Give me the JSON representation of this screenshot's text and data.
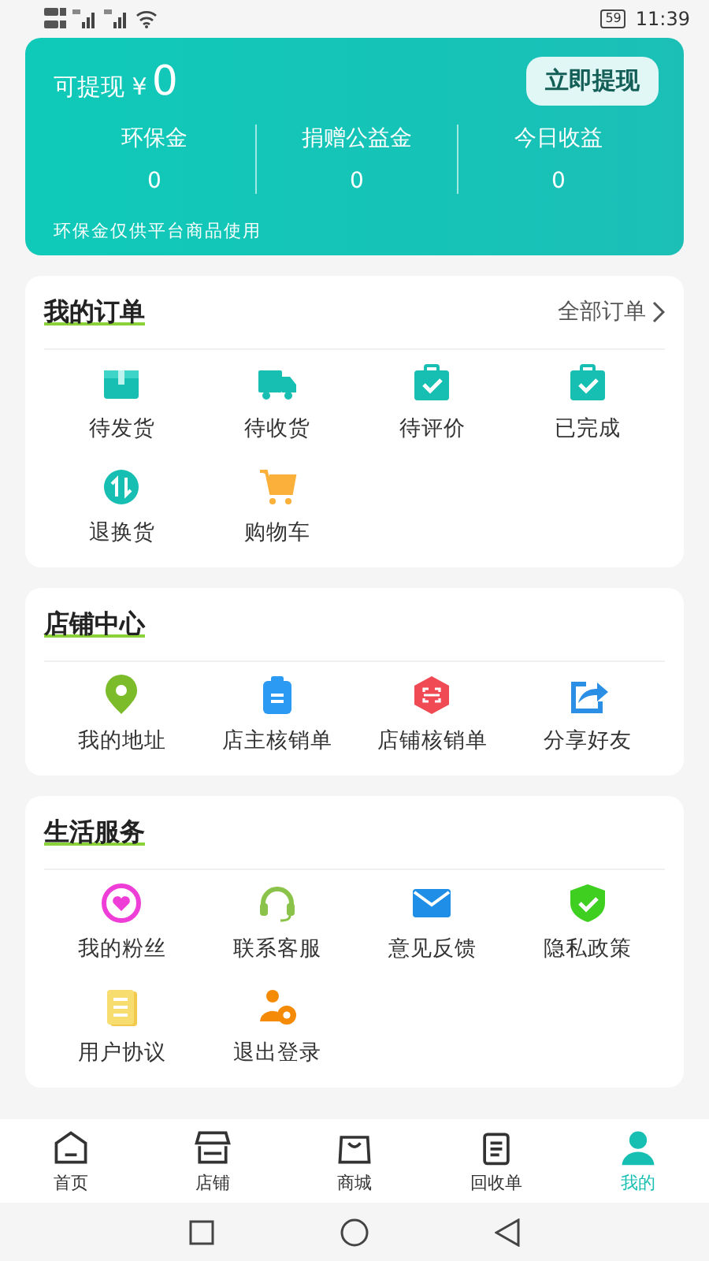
{
  "status_bar": {
    "battery": "59",
    "time": "11:39"
  },
  "balance": {
    "label": "可提现 ¥",
    "amount": "0",
    "button": "立即提现",
    "stats": [
      {
        "label": "环保金",
        "value": "0"
      },
      {
        "label": "捐赠公益金",
        "value": "0"
      },
      {
        "label": "今日收益",
        "value": "0"
      }
    ],
    "note": "环保金仅供平台商品使用"
  },
  "sections": [
    {
      "title": "我的订单",
      "link": "全部订单",
      "items": [
        "待发货",
        "待收货",
        "待评价",
        "已完成",
        "退换货",
        "购物车"
      ]
    },
    {
      "title": "店铺中心",
      "items": [
        "我的地址",
        "店主核销单",
        "店铺核销单",
        "分享好友"
      ]
    },
    {
      "title": "生活服务",
      "items": [
        "我的粉丝",
        "联系客服",
        "意见反馈",
        "隐私政策",
        "用户协议",
        "退出登录"
      ]
    }
  ],
  "tabs": [
    {
      "label": "首页",
      "selected": false
    },
    {
      "label": "店铺",
      "selected": false
    },
    {
      "label": "商城",
      "selected": false
    },
    {
      "label": "回收单",
      "selected": false
    },
    {
      "label": "我的",
      "selected": true
    }
  ]
}
